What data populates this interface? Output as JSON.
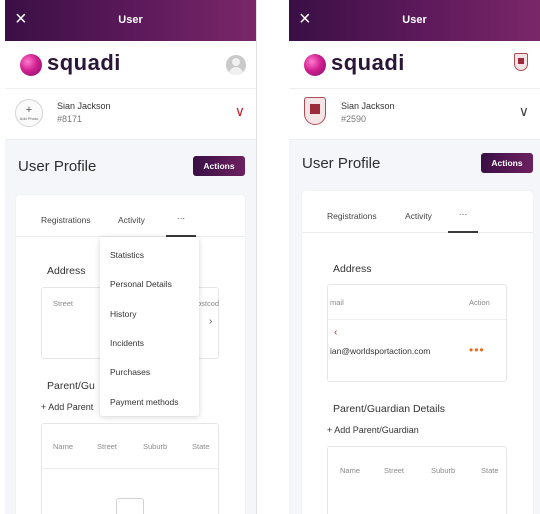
{
  "colors": {
    "accent": "#5e1a5c",
    "chevron": "#c1272d",
    "action_dots": "#e86a1a"
  },
  "left": {
    "window_title": "User",
    "close_icon": "×",
    "brand": "squadi",
    "user": {
      "name": "Sian Jackson",
      "id": "#8171",
      "add_photo_plus": "+",
      "add_photo_label": "Add Photo"
    },
    "page_title": "User Profile",
    "actions_label": "Actions",
    "tabs": {
      "registrations": "Registrations",
      "activity": "Activity",
      "more": "···"
    },
    "address": {
      "title": "Address",
      "col_street": "Street",
      "col_postcode": "Postcod",
      "scroll": "›"
    },
    "parent": {
      "title": "Parent/Gu",
      "add": "+ Add Parent",
      "columns": [
        "Name",
        "Street",
        "Suburb",
        "State"
      ]
    },
    "menu": [
      "Statistics",
      "Personal Details",
      "History",
      "Incidents",
      "Purchases",
      "Payment methods"
    ]
  },
  "right": {
    "window_title": "User",
    "close_icon": "×",
    "brand": "squadi",
    "user": {
      "name": "Sian Jackson",
      "id": "#2590"
    },
    "page_title": "User Profile",
    "actions_label": "Actions",
    "tabs": {
      "registrations": "Registrations",
      "activity": "Activity",
      "more": "···"
    },
    "address": {
      "title": "Address",
      "col_email": "mail",
      "col_action": "Action",
      "email_value": "ian@worldsportaction.com",
      "scroll": "‹",
      "action_dots": "•••"
    },
    "parent": {
      "title": "Parent/Guardian Details",
      "add": "+ Add Parent/Guardian",
      "columns": [
        "Name",
        "Street",
        "Suburb",
        "State"
      ]
    }
  }
}
